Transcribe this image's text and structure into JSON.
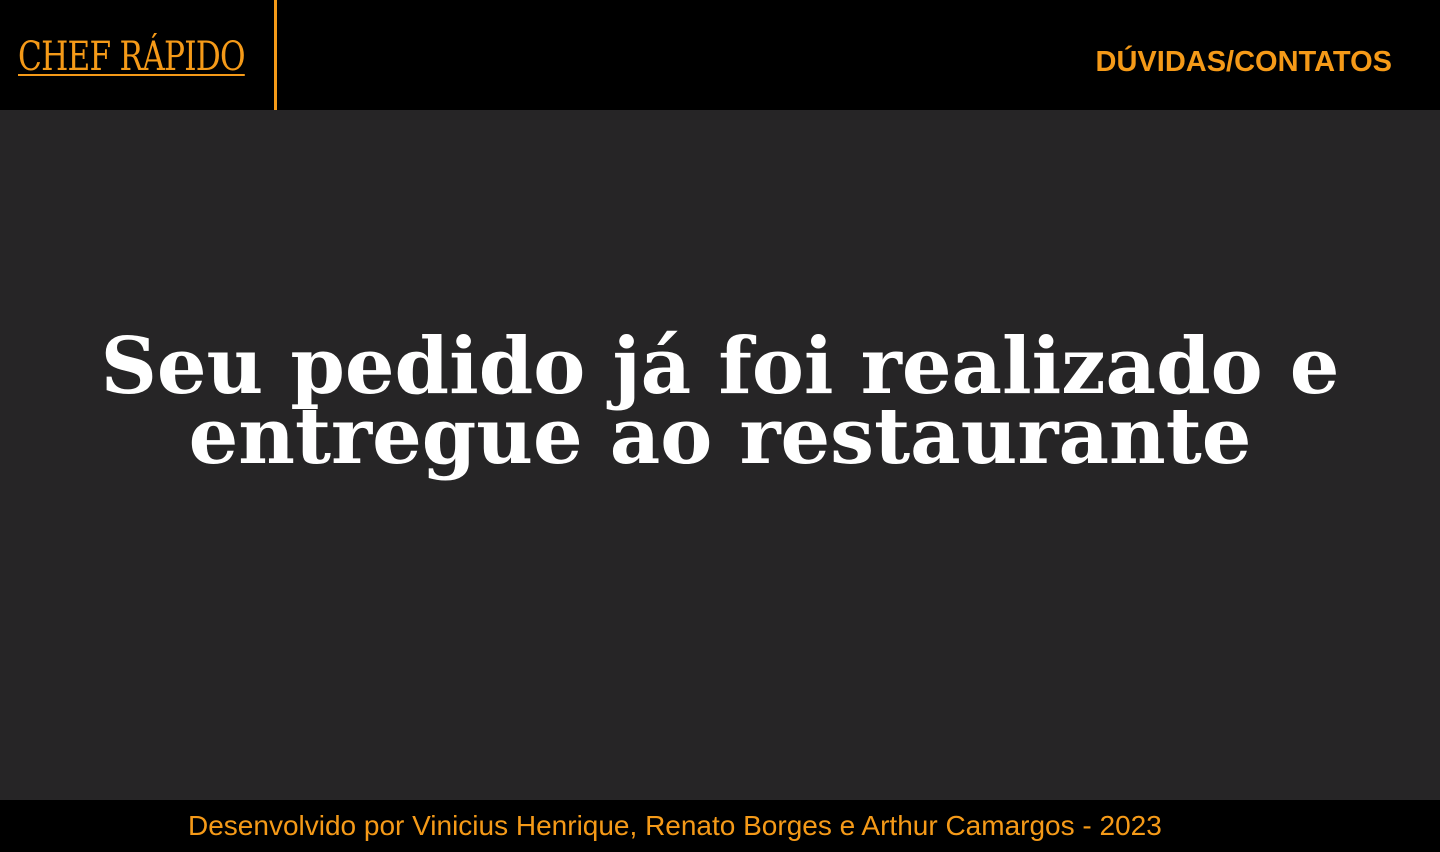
{
  "header": {
    "logo_text": "CHEF RÁPIDO",
    "nav_link": "DÚVIDAS/CONTATOS"
  },
  "main": {
    "headline_line1": "Seu pedido já foi realizado e",
    "headline_line2": "entregue ao restaurante"
  },
  "footer": {
    "credits": "Desenvolvido por Vinicius Henrique, Renato Borges e Arthur Camargos - 2023"
  },
  "colors": {
    "accent": "#f59a18",
    "header_bg": "#000000",
    "main_bg": "#262526",
    "headline": "#ffffff"
  }
}
